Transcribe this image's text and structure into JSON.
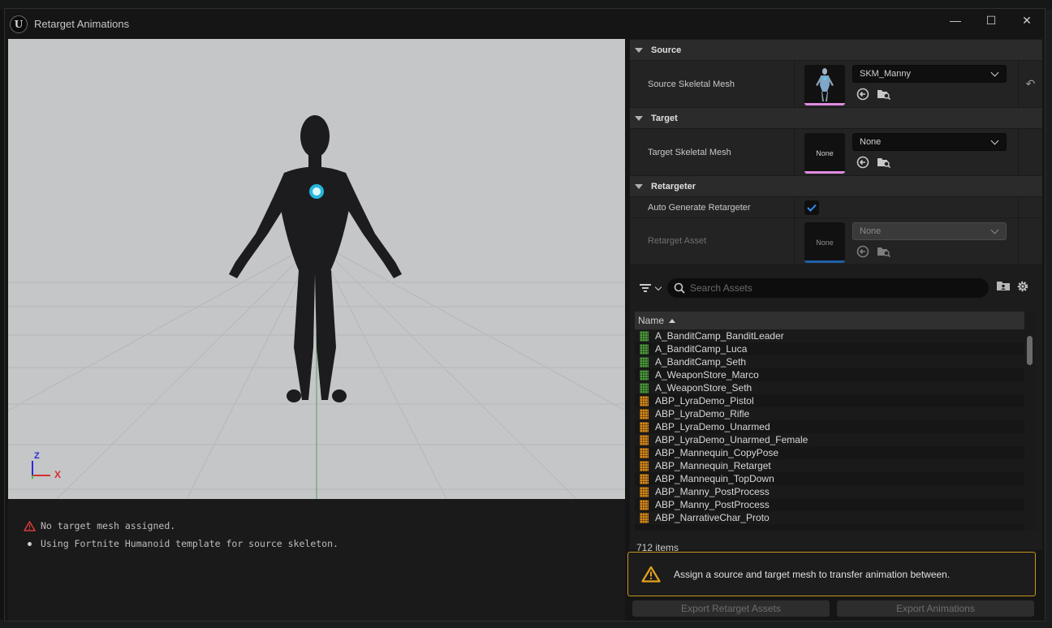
{
  "window": {
    "title": "Retarget Animations",
    "controls": {
      "minimize": "—",
      "maximize": "☐",
      "close": "✕"
    }
  },
  "viewport": {
    "axes": {
      "z": "Z",
      "x": "X"
    }
  },
  "messages": [
    {
      "type": "error",
      "text": "No target mesh assigned."
    },
    {
      "type": "info",
      "text": "Using Fortnite Humanoid template for source skeleton."
    }
  ],
  "details": {
    "source": {
      "header": "Source",
      "prop_label": "Source Skeletal Mesh",
      "value": "SKM_Manny",
      "reset_icon": "↶"
    },
    "target": {
      "header": "Target",
      "prop_label": "Target Skeletal Mesh",
      "value": "None",
      "thumb_text": "None"
    },
    "retargeter": {
      "header": "Retargeter",
      "auto_label": "Auto Generate Retargeter",
      "auto_checked": true,
      "asset_label": "Retarget Asset",
      "asset_value": "None",
      "thumb_text": "None"
    }
  },
  "browser": {
    "search_placeholder": "Search Assets",
    "column_name": "Name",
    "items": [
      {
        "name": "A_BanditCamp_BanditLeader",
        "kind": "anim"
      },
      {
        "name": "A_BanditCamp_Luca",
        "kind": "anim"
      },
      {
        "name": "A_BanditCamp_Seth",
        "kind": "anim"
      },
      {
        "name": "A_WeaponStore_Marco",
        "kind": "anim"
      },
      {
        "name": "A_WeaponStore_Seth",
        "kind": "anim"
      },
      {
        "name": "ABP_LyraDemo_Pistol",
        "kind": "blueprint"
      },
      {
        "name": "ABP_LyraDemo_Rifle",
        "kind": "blueprint"
      },
      {
        "name": "ABP_LyraDemo_Unarmed",
        "kind": "blueprint"
      },
      {
        "name": "ABP_LyraDemo_Unarmed_Female",
        "kind": "blueprint"
      },
      {
        "name": "ABP_Mannequin_CopyPose",
        "kind": "blueprint"
      },
      {
        "name": "ABP_Mannequin_Retarget",
        "kind": "blueprint"
      },
      {
        "name": "ABP_Mannequin_TopDown",
        "kind": "blueprint"
      },
      {
        "name": "ABP_Manny_PostProcess",
        "kind": "blueprint"
      },
      {
        "name": "ABP_Manny_PostProcess",
        "kind": "blueprint"
      },
      {
        "name": "ABP_NarrativeChar_Proto",
        "kind": "blueprint"
      }
    ],
    "item_count": "712 items",
    "colors": {
      "anim": "#4e9a3e",
      "blueprint": "#d98a1c"
    }
  },
  "warning": {
    "text": "Assign a source and target mesh to transfer animation between."
  },
  "buttons": {
    "export_retarget_assets": "Export Retarget Assets",
    "export_animations": "Export Animations"
  }
}
